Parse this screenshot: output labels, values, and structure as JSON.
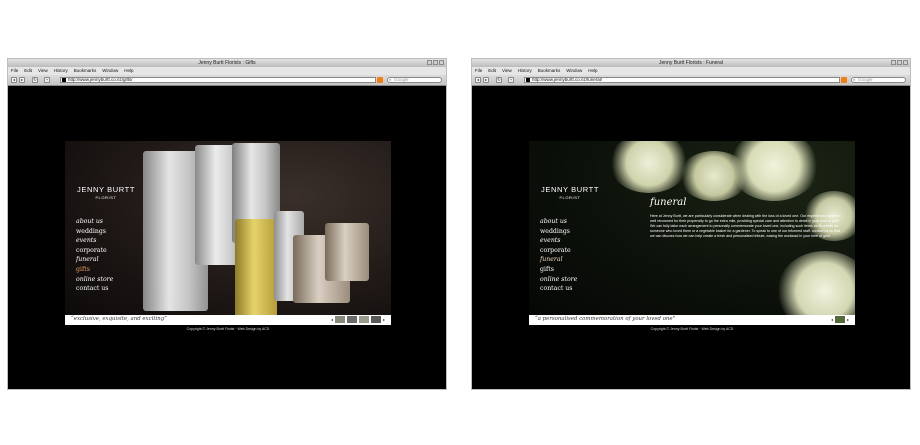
{
  "windows": [
    {
      "title": "Jenny Burtt Florists : Gifts",
      "menu": [
        "File",
        "Edit",
        "View",
        "History",
        "Bookmarks",
        "Window",
        "Help"
      ],
      "url": "http://www.jennyburtt.co.nz/gifts/",
      "search_placeholder": "Google",
      "site": {
        "brand_name": "JENNY BURTT",
        "brand_sub": "FLORIST",
        "nav": [
          "about us",
          "weddings",
          "events",
          "corporate",
          "funeral",
          "gifts",
          "online store",
          "contact us"
        ],
        "active_nav": "gifts",
        "tagline": "“exclusive, exquisite, and exciting”",
        "copyright": "Copyright © Jenny Burtt Florist · Web Design by ACD",
        "accent_color": "#e89a63"
      }
    },
    {
      "title": "Jenny Burtt Florists : Funeral",
      "menu": [
        "File",
        "Edit",
        "View",
        "History",
        "Bookmarks",
        "Window",
        "Help"
      ],
      "url": "http://www.jennyburtt.co.nz/funeral/",
      "search_placeholder": "Google",
      "site": {
        "brand_name": "JENNY BURTT",
        "brand_sub": "FLORIST",
        "nav": [
          "about us",
          "weddings",
          "events",
          "corporate",
          "funeral",
          "gifts",
          "online store",
          "contact us"
        ],
        "active_nav": "funeral",
        "page_heading": "funeral",
        "body_text": "Here at Jenny Burtt, we are particularly considerate when dealing with the loss of a loved one. Our experienced staff are well renowned for their propensity to go the extra mile, providing special care and attention to detail in your time of grief. We can fully tailor each arrangement to personally commemorate your loved one, including such items as Bluebells for someone who loved them or a vegetable basket for a gardener. To speak to one of our informed staff, contact us so that we can discuss how we can help create a fresh and personalised tribute, easing the workload in your time of grief.",
        "tagline": "“a personalised commemoration of your loved one”",
        "copyright": "Copyright © Jenny Burtt Florist · Web Design by ACD"
      }
    }
  ]
}
